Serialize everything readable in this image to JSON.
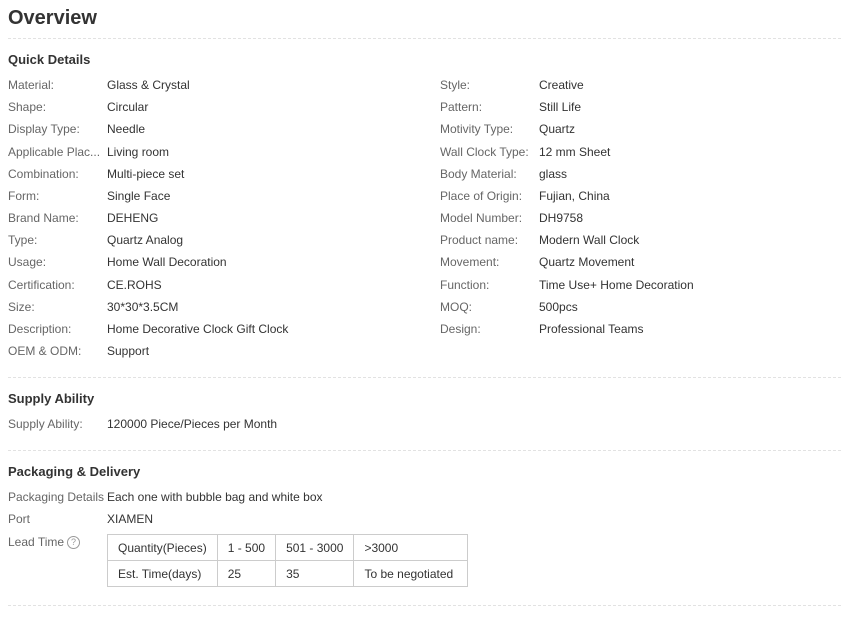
{
  "page_title": "Overview",
  "quick_details": {
    "heading": "Quick Details",
    "left": [
      {
        "label": "Material:",
        "value": "Glass & Crystal"
      },
      {
        "label": "Shape:",
        "value": "Circular"
      },
      {
        "label": "Display Type:",
        "value": "Needle"
      },
      {
        "label": "Applicable Plac...",
        "value": "Living room"
      },
      {
        "label": "Combination:",
        "value": "Multi-piece set"
      },
      {
        "label": "Form:",
        "value": "Single Face"
      },
      {
        "label": "Brand Name:",
        "value": "DEHENG"
      },
      {
        "label": "Type:",
        "value": "Quartz Analog"
      },
      {
        "label": "Usage:",
        "value": "Home Wall Decoration"
      },
      {
        "label": "Certification:",
        "value": "CE.ROHS"
      },
      {
        "label": "Size:",
        "value": "30*30*3.5CM"
      },
      {
        "label": "Description:",
        "value": "Home Decorative Clock Gift Clock"
      },
      {
        "label": "OEM & ODM:",
        "value": "Support"
      }
    ],
    "right": [
      {
        "label": "Style:",
        "value": "Creative"
      },
      {
        "label": "Pattern:",
        "value": "Still Life"
      },
      {
        "label": "Motivity Type:",
        "value": "Quartz"
      },
      {
        "label": "Wall Clock Type:",
        "value": "12 mm Sheet"
      },
      {
        "label": "Body Material:",
        "value": "glass"
      },
      {
        "label": "Place of Origin:",
        "value": "Fujian, China"
      },
      {
        "label": "Model Number:",
        "value": "DH9758"
      },
      {
        "label": "Product name:",
        "value": "Modern Wall Clock"
      },
      {
        "label": "Movement:",
        "value": "Quartz Movement"
      },
      {
        "label": "Function:",
        "value": "Time Use+ Home Decoration"
      },
      {
        "label": "MOQ:",
        "value": "500pcs"
      },
      {
        "label": "Design:",
        "value": "Professional Teams"
      }
    ]
  },
  "supply_ability": {
    "heading": "Supply Ability",
    "label": "Supply Ability:",
    "value": "120000 Piece/Pieces per Month"
  },
  "packaging": {
    "heading": "Packaging & Delivery",
    "details_label": "Packaging Details",
    "details_value": "Each one with bubble bag and white box",
    "port_label": "Port",
    "port_value": "XIAMEN",
    "lead_time_label": "Lead Time",
    "help_icon": "question-circle-icon",
    "help_glyph": "?",
    "lead_table": {
      "rows": [
        [
          "Quantity(Pieces)",
          "1 - 500",
          "501 - 3000",
          ">3000"
        ],
        [
          "Est. Time(days)",
          "25",
          "35",
          "To be negotiated"
        ]
      ]
    }
  }
}
